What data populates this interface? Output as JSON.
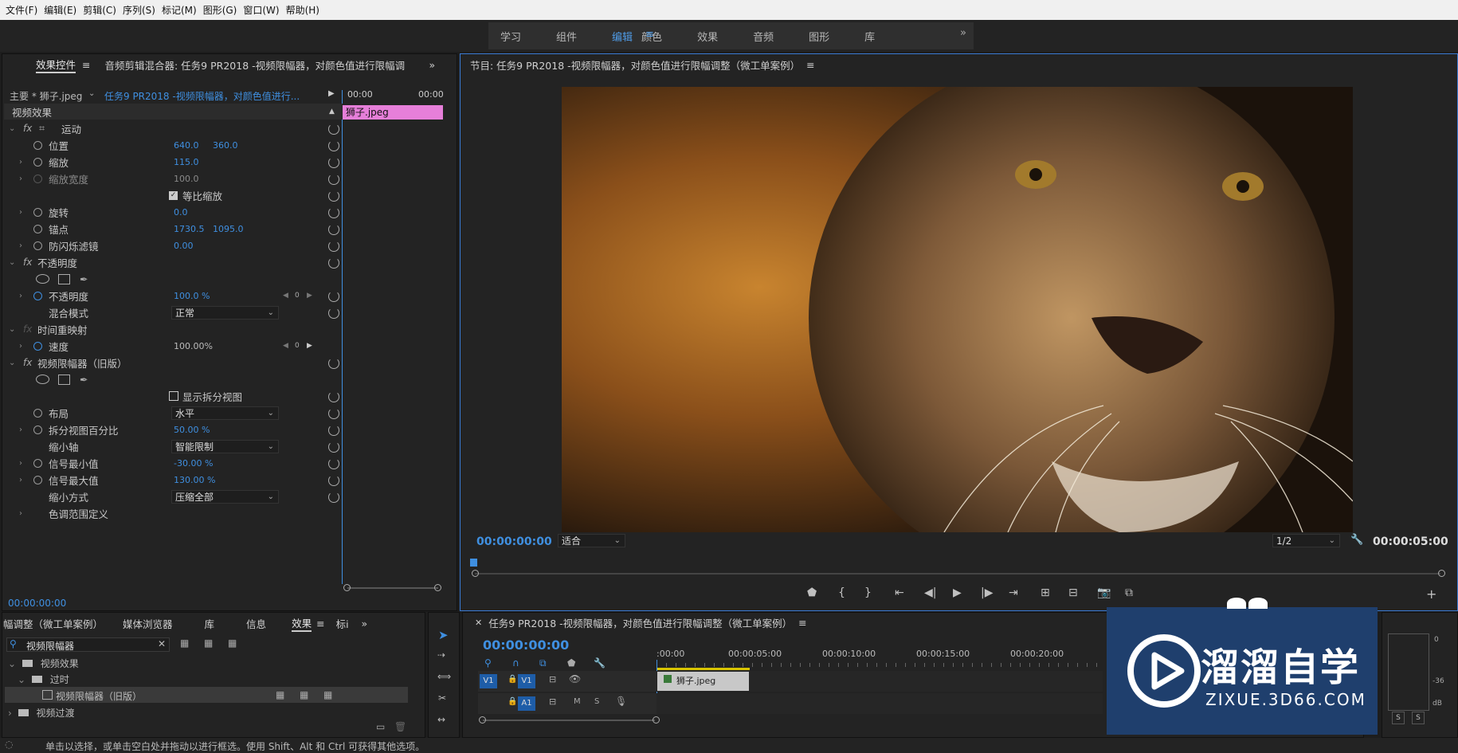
{
  "menu": [
    "文件(F)",
    "编辑(E)",
    "剪辑(C)",
    "序列(S)",
    "标记(M)",
    "图形(G)",
    "窗口(W)",
    "帮助(H)"
  ],
  "workspaces": [
    {
      "label": "学习"
    },
    {
      "label": "组件"
    },
    {
      "label": "编辑"
    },
    {
      "label": "颜色"
    },
    {
      "label": "效果"
    },
    {
      "label": "音频"
    },
    {
      "label": "图形"
    },
    {
      "label": "库"
    }
  ],
  "effect_panel": {
    "tab_effects": "效果控件",
    "tab_mixer": "音频剪辑混合器: 任务9 PR2018 -视频限幅器，对颜色值进行限幅调",
    "master_clip": "主要 * 狮子.jpeg",
    "sequence_clip": "任务9 PR2018 -视频限幅器，对颜色值进行...",
    "time_start": "00:00",
    "time_end": "00:00",
    "clip_name": "狮子.jpeg",
    "section_video": "视频效果",
    "motion": "运动",
    "position_label": "位置",
    "position_x": "640.0",
    "position_y": "360.0",
    "scale_label": "缩放",
    "scale_val": "115.0",
    "scale_width_label": "缩放宽度",
    "scale_width_val": "100.0",
    "uniform_scale": "等比缩放",
    "rotation_label": "旋转",
    "rotation_val": "0.0",
    "anchor_label": "锚点",
    "anchor_x": "1730.5",
    "anchor_y": "1095.0",
    "antiflicker_label": "防闪烁滤镜",
    "antiflicker_val": "0.00",
    "opacity_section": "不透明度",
    "opacity_label": "不透明度",
    "opacity_val": "100.0 %",
    "blend_label": "混合模式",
    "blend_val": "正常",
    "time_remap": "时间重映射",
    "speed_label": "速度",
    "speed_val": "100.00%",
    "limiter_section": "视频限幅器（旧版）",
    "split_view": "显示拆分视图",
    "layout_label": "布局",
    "layout_val": "水平",
    "split_pct_label": "拆分视图百分比",
    "split_pct_val": "50.00 %",
    "reduce_axis_label": "缩小轴",
    "reduce_axis_val": "智能限制",
    "signal_min_label": "信号最小值",
    "signal_min_val": "-30.00 %",
    "signal_max_label": "信号最大值",
    "signal_max_val": "130.00 %",
    "reduce_method_label": "缩小方式",
    "reduce_method_val": "压缩全部",
    "tonal_range": "色调范围定义",
    "timecode": "00:00:00:00",
    "keyframe_zero": "0"
  },
  "program": {
    "title": "节目: 任务9 PR2018 -视频限幅器，对颜色值进行限幅调整（微工单案例）",
    "timecode": "00:00:00:00",
    "fit": "适合",
    "resolution": "1/2",
    "duration": "00:00:05:00"
  },
  "effects_browser": {
    "tabs": [
      "幅调整（微工单案例）",
      "媒体浏览器",
      "库",
      "信息",
      "效果",
      "标i"
    ],
    "search": "视频限幅器",
    "tree": [
      "视频效果",
      "过时",
      "视频限幅器（旧版）",
      "视频过渡"
    ]
  },
  "timeline": {
    "title": "任务9 PR2018 -视频限幅器，对颜色值进行限幅调整（微工单案例）",
    "timecode": "00:00:00:00",
    "ruler": [
      ":00:00",
      "00:00:05:00",
      "00:00:10:00",
      "00:00:15:00",
      "00:00:20:00"
    ],
    "v1": "V1",
    "a1": "A1",
    "m": "M",
    "s": "S",
    "clip": "狮子.jpeg"
  },
  "meter": {
    "labels": [
      "0",
      "-36",
      "dB"
    ],
    "solo": [
      "S",
      "S"
    ]
  },
  "watermark": {
    "title": "溜溜自学",
    "url": "ZIXUE.3D66.COM"
  },
  "status": "单击以选择，或单击空白处并拖动以进行框选。使用 Shift、Alt 和 Ctrl 可获得其他选项。"
}
